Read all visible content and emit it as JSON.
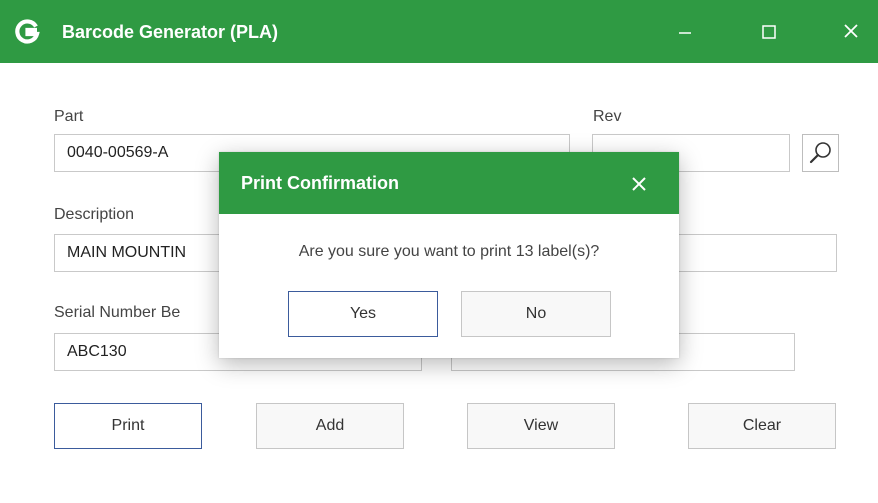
{
  "window": {
    "title": "Barcode Generator (PLA)",
    "logo_icon": "g-logo-icon",
    "controls": [
      "minimize-icon",
      "maximize-icon",
      "close-icon"
    ]
  },
  "form": {
    "part": {
      "label": "Part",
      "value": "0040-00569-A"
    },
    "rev": {
      "label": "Rev",
      "value": ""
    },
    "description": {
      "label": "Description",
      "value": "MAIN MOUNTIN"
    },
    "serial": {
      "label": "Serial Number Be",
      "value": "ABC130"
    },
    "right_field": {
      "value": ""
    }
  },
  "buttons": {
    "print": "Print",
    "add": "Add",
    "view": "View",
    "clear": "Clear"
  },
  "dialog": {
    "title": "Print Confirmation",
    "message": "Are you sure you want to print 13 label(s)?",
    "yes": "Yes",
    "no": "No"
  },
  "colors": {
    "accent": "#2f9a43",
    "primary_border": "#3b5b9c"
  }
}
